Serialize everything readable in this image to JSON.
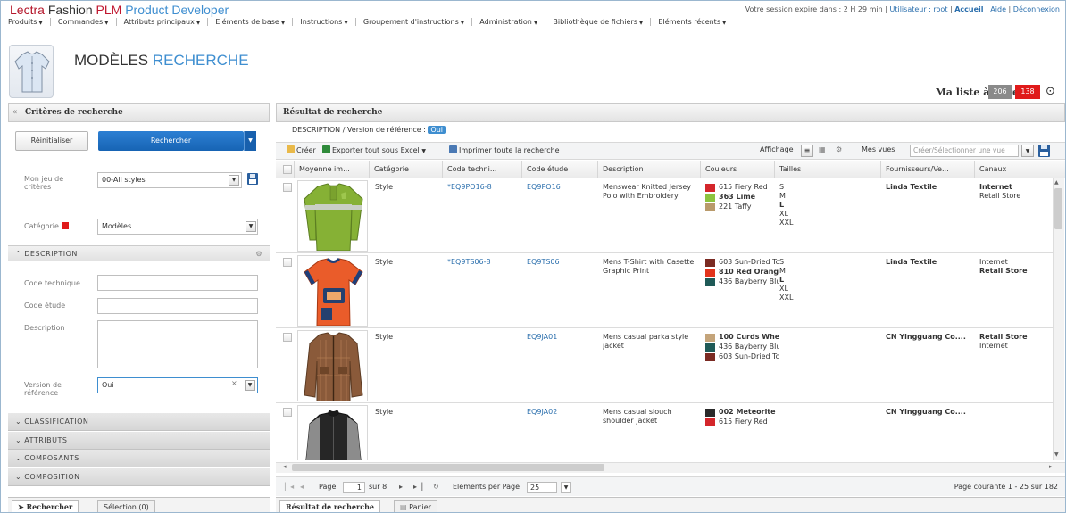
{
  "app": {
    "brand_w1": "Lectra",
    "brand_w2": "Fashion",
    "brand_w3": "PLM",
    "brand_w4": "Product Developer",
    "session_text": "Votre session expire dans : 2 H 29 min |",
    "user": "Utilisateur : root",
    "home": "Accueil",
    "help": "Aide",
    "logout": "Déconnexion"
  },
  "menu": [
    "Produits",
    "Commandes",
    "Attributs principaux",
    "Eléments de base",
    "Instructions",
    "Groupement d'instructions",
    "Administration",
    "Bibliothèque de fichiers",
    "Eléments récents"
  ],
  "page": {
    "title_part1": "MODÈLES",
    "title_part2": "RECHERCHE"
  },
  "todo": {
    "label": "Ma liste à faire",
    "count1": "206",
    "count2": "138"
  },
  "criteria": {
    "header": "Critères de recherche",
    "reset": "Réinitialiser",
    "search": "Rechercher",
    "set_label": "Mon jeu de critères",
    "set_value": "00-All styles",
    "category_label": "Catégorie",
    "category_value": "Modèles",
    "description_section": "DESCRIPTION",
    "code_tech_label": "Code technique",
    "code_study_label": "Code étude",
    "description_label": "Description",
    "version_label": "Version de référence",
    "version_value": "Oui",
    "sections": [
      "CLASSIFICATION",
      "ATTRIBUTS",
      "COMPOSANTS",
      "COMPOSITION"
    ],
    "tab_search": "Rechercher",
    "tab_selection": "Sélection (0)"
  },
  "results": {
    "header": "Résultat de recherche",
    "crumb_text": "DESCRIPTION / Version de référence :",
    "crumb_value": "Oui",
    "tb_create": "Créer",
    "tb_export": "Exporter tout sous Excel",
    "tb_print": "Imprimer toute la recherche",
    "display_label": "Affichage",
    "views_label": "Mes vues",
    "views_placeholder": "Créer/Sélectionner une vue",
    "columns": [
      "Moyenne im...",
      "Catégorie",
      "Code techni...",
      "Code étude",
      "Description",
      "Couleurs",
      "Tailles",
      "Fournisseurs/Ve...",
      "Canaux"
    ],
    "rows": [
      {
        "category": "Style",
        "code_tech": "*EQ9PO16-8",
        "code_study": "EQ9PO16",
        "description": "Menswear Knitted Jersey Polo with Embroidery",
        "colors": [
          {
            "name": "615 Fiery Red",
            "hex": "#d4262b",
            "bold": false
          },
          {
            "name": "363 Lime",
            "hex": "#8dc43f",
            "bold": true
          },
          {
            "name": "221 Taffy",
            "hex": "#b99a6b",
            "bold": false
          }
        ],
        "sizes": [
          {
            "v": "S",
            "b": false
          },
          {
            "v": "M",
            "b": false
          },
          {
            "v": "L",
            "b": true
          },
          {
            "v": "XL",
            "b": false
          },
          {
            "v": "XXL",
            "b": false
          }
        ],
        "supplier": "Linda Textile",
        "channels": [
          {
            "v": "Internet",
            "b": true
          },
          {
            "v": "Retail Store",
            "b": false
          }
        ]
      },
      {
        "category": "Style",
        "code_tech": "*EQ9TS06-8",
        "code_study": "EQ9TS06",
        "description": "Mens T-Shirt with Casette Graphic Print",
        "colors": [
          {
            "name": "603 Sun-Dried To...",
            "hex": "#7a2a22",
            "bold": false
          },
          {
            "name": "810 Red Orange",
            "hex": "#e2341c",
            "bold": true
          },
          {
            "name": "436 Bayberry Blue",
            "hex": "#1f5a57",
            "bold": false
          }
        ],
        "sizes": [
          {
            "v": "S",
            "b": false
          },
          {
            "v": "M",
            "b": false
          },
          {
            "v": "L",
            "b": true
          },
          {
            "v": "XL",
            "b": false
          },
          {
            "v": "XXL",
            "b": false
          }
        ],
        "supplier": "Linda Textile",
        "channels": [
          {
            "v": "Internet",
            "b": false
          },
          {
            "v": "Retail Store",
            "b": true
          }
        ]
      },
      {
        "category": "Style",
        "code_tech": "",
        "code_study": "EQ9JA01",
        "description": "Mens casual parka style jacket",
        "colors": [
          {
            "name": "100 Curds Whey",
            "hex": "#c4a47a",
            "bold": true
          },
          {
            "name": "436 Bayberry Blue",
            "hex": "#1f5a57",
            "bold": false
          },
          {
            "name": "603 Sun-Dried To...",
            "hex": "#7a2a22",
            "bold": false
          }
        ],
        "sizes": [],
        "supplier": "CN Yingguang Co....",
        "channels": [
          {
            "v": "Retail Store",
            "b": true
          },
          {
            "v": "Internet",
            "b": false
          }
        ]
      },
      {
        "category": "Style",
        "code_tech": "",
        "code_study": "EQ9JA02",
        "description": "Mens casual slouch shoulder jacket",
        "colors": [
          {
            "name": "002 Meteorite",
            "hex": "#2a2a2a",
            "bold": true
          },
          {
            "name": "615 Fiery Red",
            "hex": "#d4262b",
            "bold": false
          }
        ],
        "sizes": [],
        "supplier": "CN Yingguang Co....",
        "channels": []
      }
    ],
    "pager": {
      "page_label": "Page",
      "page_value": "1",
      "of": "sur 8",
      "per_page_label": "Elements per Page",
      "per_page": "25",
      "status": "Page courante 1 - 25 sur 182"
    },
    "tab_results": "Résultat de recherche",
    "tab_cart": "Panier"
  },
  "colors": {
    "accent": "#3e8ed0",
    "brand_red": "#c0172f",
    "primary_button": "#1f6fc1",
    "alert": "#e01a1a"
  }
}
